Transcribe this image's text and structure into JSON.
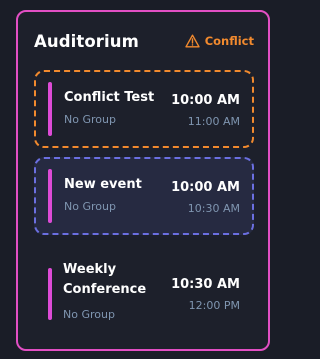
{
  "room": {
    "title": "Auditorium",
    "conflict_label": "Conflict",
    "conflict_icon": "warning-triangle-icon"
  },
  "colors": {
    "card_border": "#e24fc4",
    "conflict": "#f28a2e",
    "selected_border": "#6b6fe0",
    "event_bar": "#dd4bd6",
    "muted_text": "#7f95b0"
  },
  "events": [
    {
      "title": "Conflict Test",
      "group": "No Group",
      "start": "10:00 AM",
      "end": "11:00 AM",
      "state": "conflict"
    },
    {
      "title": "New event",
      "group": "No Group",
      "start": "10:00 AM",
      "end": "10:30 AM",
      "state": "selected"
    },
    {
      "title": "Weekly Conference",
      "group": "No Group",
      "start": "10:30 AM",
      "end": "12:00 PM",
      "state": "normal"
    }
  ]
}
